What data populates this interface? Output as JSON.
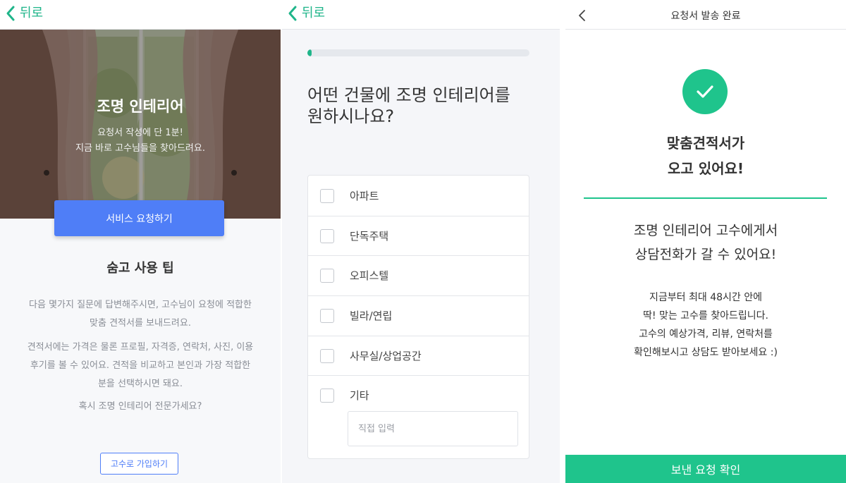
{
  "colors": {
    "accent_green": "#1fc48c",
    "accent_blue": "#4f7ef7"
  },
  "screen1": {
    "back_label": "뒤로",
    "hero_title": "조명 인테리어",
    "hero_sub_1": "요청서 작성에 단 1분!",
    "hero_sub_2": "지금 바로 고수님들을 찾아드려요.",
    "service_button": "서비스 요청하기",
    "tips_title": "숨고 사용 팁",
    "tips_p1_1": "다음 몇가지 질문에 답변해주시면, 고수님이 요청에 적합한",
    "tips_p1_2": "맞춤 견적서를 보내드려요.",
    "tips_p2_1": "견적서에는 가격은 물론 프로필, 자격증, 연락처, 사진, 이용",
    "tips_p2_2": "후기를 볼 수 있어요. 견적을 비교하고 본인과 가장 적합한",
    "tips_p2_3": "분을 선택하시면 돼요.",
    "tips_p3": "혹시 조명 인테리어 전문가세요?",
    "pro_signup_button": "고수로 가입하기"
  },
  "screen2": {
    "back_label": "뒤로",
    "progress": 0.02,
    "question_1": "어떤 건물에 조명 인테리어를",
    "question_2": "원하시나요?",
    "options": [
      "아파트",
      "단독주택",
      "오피스텔",
      "빌라/연립",
      "사무실/상업공간",
      "기타"
    ],
    "direct_input_placeholder": "직접 입력"
  },
  "screen3": {
    "title": "요청서 발송 완료",
    "headline_1": "맞춤견적서가",
    "headline_2": "오고 있어요!",
    "sub_1": "조명 인테리어 고수에게서",
    "sub_2": "상담전화가 갈 수 있어요!",
    "desc_1": "지금부터 최대 48시간 안에",
    "desc_2": "딱! 맞는 고수를 찾아드립니다.",
    "desc_3": "고수의 예상가격, 리뷰, 연락처를",
    "desc_4": "확인해보시고 상담도 받아보세요 :)",
    "confirm_button": "보낸 요청 확인"
  }
}
